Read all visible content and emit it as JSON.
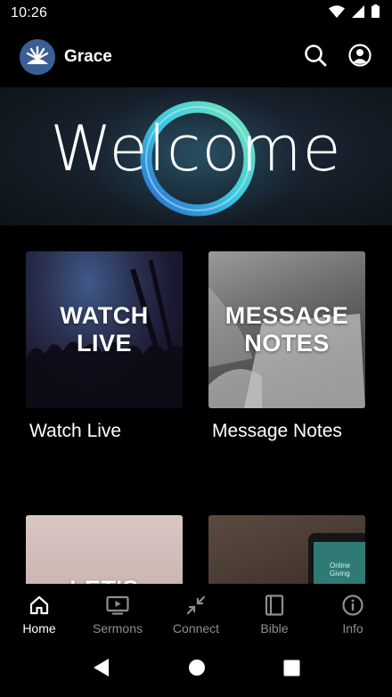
{
  "status": {
    "time": "10:26",
    "icons": [
      "wifi-icon",
      "cellular-icon",
      "battery-icon"
    ]
  },
  "app_bar": {
    "title": "Grace",
    "logo": "grace-logo",
    "actions": [
      "search-icon",
      "account-icon"
    ]
  },
  "hero": {
    "text": "Welcome"
  },
  "tiles": [
    {
      "image_text": "WATCH\nLIVE",
      "label": "Watch Live"
    },
    {
      "image_text": "MESSAGE\nNOTES",
      "label": "Message Notes"
    },
    {
      "image_text": "LET'S",
      "label": ""
    },
    {
      "image_text": "",
      "label": "",
      "image_detail": "Online Giving"
    }
  ],
  "bottom_nav": {
    "items": [
      {
        "label": "Home",
        "icon": "home-icon",
        "active": true
      },
      {
        "label": "Sermons",
        "icon": "tv-icon",
        "active": false
      },
      {
        "label": "Connect",
        "icon": "arrows-in-icon",
        "active": false
      },
      {
        "label": "Bible",
        "icon": "book-icon",
        "active": false
      },
      {
        "label": "Info",
        "icon": "info-icon",
        "active": false
      }
    ]
  },
  "system_nav": [
    "back-icon",
    "home-circle-icon",
    "recents-icon"
  ],
  "colors": {
    "background": "#000000",
    "active": "#ffffff",
    "inactive": "#8e8e8e",
    "ring": "#3fd0e8"
  }
}
